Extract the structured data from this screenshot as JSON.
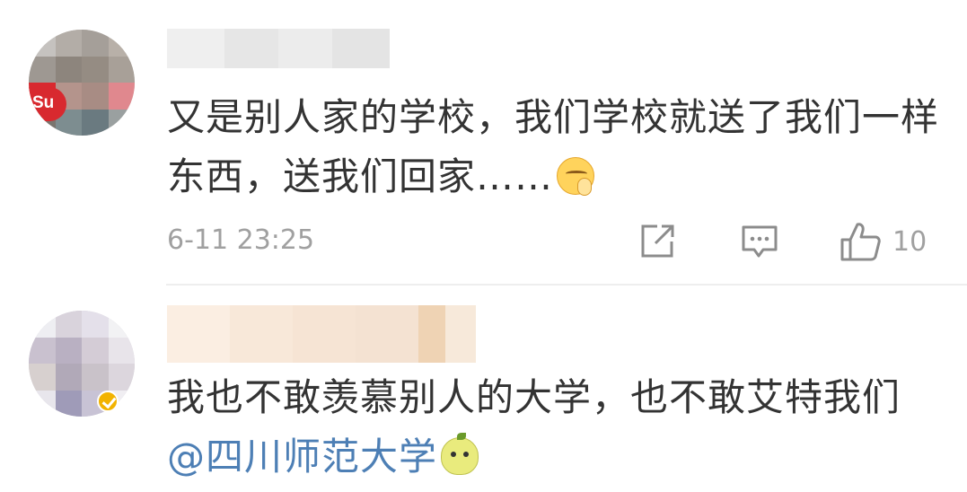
{
  "comments": [
    {
      "text": "又是别人家的学校，我们学校就送了我们一样东西，送我们回家……",
      "emoji": "shushing-face-icon",
      "timestamp": "6-11 23:25",
      "like_count": "10",
      "actions": [
        "share-icon",
        "reply-icon",
        "like-icon"
      ]
    },
    {
      "text": "我也不敢羡慕别人的大学，也不敢艾特我们",
      "mention": "@四川师范大学",
      "emoji": "lemon-face-icon"
    }
  ],
  "colors": {
    "text": "#333333",
    "meta": "#a0a0a0",
    "mention": "#4d7fb5",
    "divider": "#eeeeee",
    "verified_badge": "#f2b300"
  }
}
